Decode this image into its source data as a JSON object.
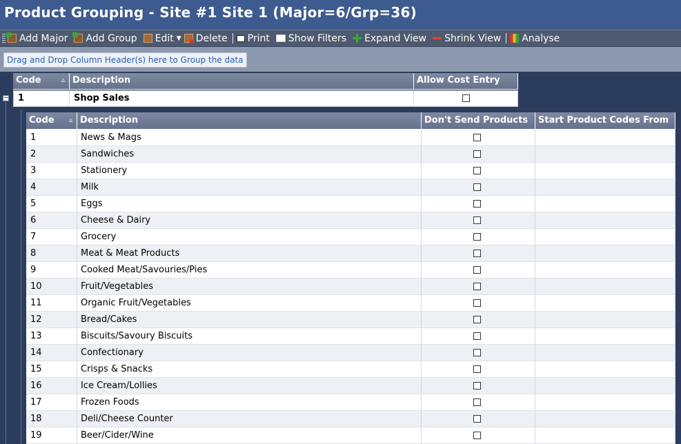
{
  "window": {
    "title": "Product Grouping - Site #1 Site 1 (Major=6/Grp=36)"
  },
  "toolbar": {
    "add_major": "Add Major",
    "add_group": "Add Group",
    "edit": "Edit",
    "delete": "Delete",
    "print": "Print",
    "show_filters": "Show Filters",
    "expand_view": "Expand View",
    "shrink_view": "Shrink View",
    "analyse": "Analyse"
  },
  "group_panel": {
    "hint": "Drag and Drop Column Header(s) here to Group the data"
  },
  "major_grid": {
    "columns": [
      "Code",
      "Description",
      "Allow Cost Entry"
    ],
    "row": {
      "code": "1",
      "description": "Shop Sales",
      "allow_cost_entry": false
    }
  },
  "group_grid": {
    "columns": [
      "Code",
      "Description",
      "Don't Send Products",
      "Start Product Codes From"
    ],
    "rows": [
      {
        "code": "1",
        "description": "News & Mags"
      },
      {
        "code": "2",
        "description": "Sandwiches"
      },
      {
        "code": "3",
        "description": "Stationery"
      },
      {
        "code": "4",
        "description": "Milk"
      },
      {
        "code": "5",
        "description": "Eggs"
      },
      {
        "code": "6",
        "description": "Cheese & Dairy"
      },
      {
        "code": "7",
        "description": "Grocery"
      },
      {
        "code": "8",
        "description": "Meat & Meat Products"
      },
      {
        "code": "9",
        "description": "Cooked Meat/Savouries/Pies"
      },
      {
        "code": "10",
        "description": "Fruit/Vegetables"
      },
      {
        "code": "11",
        "description": "Organic Fruit/Vegetables"
      },
      {
        "code": "12",
        "description": "Bread/Cakes"
      },
      {
        "code": "13",
        "description": "Biscuits/Savoury Biscuits"
      },
      {
        "code": "14",
        "description": "Confectionary"
      },
      {
        "code": "15",
        "description": "Crisps & Snacks"
      },
      {
        "code": "16",
        "description": "Ice Cream/Lollies"
      },
      {
        "code": "17",
        "description": "Frozen Foods"
      },
      {
        "code": "18",
        "description": "Deli/Cheese Counter"
      },
      {
        "code": "19",
        "description": "Beer/Cider/Wine"
      }
    ]
  }
}
